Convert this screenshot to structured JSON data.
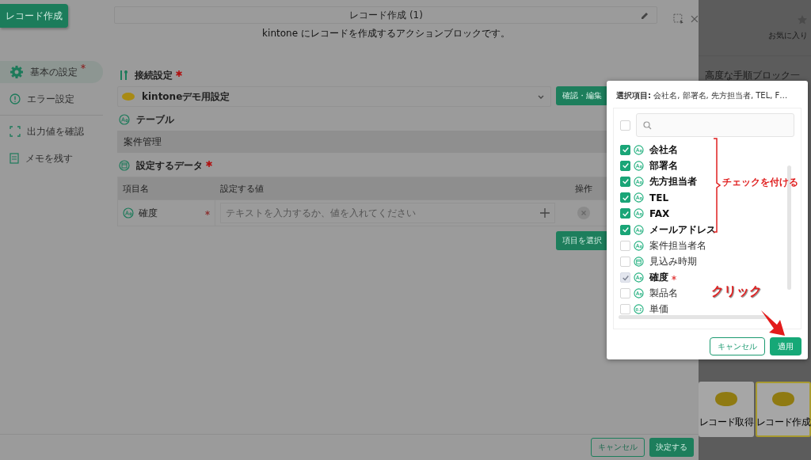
{
  "header": {
    "button": "レコード作成",
    "title": "レコード作成 (1)",
    "subtitle": "kintone にレコードを作成するアクションブロックです。"
  },
  "nav": [
    {
      "label": "基本の設定",
      "required": true,
      "selected": true,
      "kind": "gear"
    },
    {
      "label": "エラー設定",
      "required": false,
      "selected": false,
      "kind": "alert"
    },
    {
      "label": "出力値を確認",
      "required": false,
      "selected": false,
      "kind": "frame"
    },
    {
      "label": "メモを残す",
      "required": false,
      "selected": false,
      "kind": "memo"
    }
  ],
  "connection": {
    "label": "接続設定",
    "required": true,
    "value": "kintoneデモ用設定",
    "button": "確認・編集"
  },
  "table_section": {
    "label": "テーブル",
    "value": "案件管理"
  },
  "data_section": {
    "label": "設定するデータ",
    "required": true,
    "columns": [
      "項目名",
      "設定する値",
      "操作"
    ],
    "rows": [
      {
        "name": "確度",
        "required": true,
        "placeholder": "テキストを入力するか、値を入れてください"
      }
    ],
    "select_button": "項目を選択"
  },
  "footer": {
    "cancel": "キャンセル",
    "ok": "決定する"
  },
  "right_panel": {
    "favorite": "お気に入り",
    "heading": "高度な手順ブロック一",
    "cards": [
      {
        "label": "レコード取得",
        "selected": false
      },
      {
        "label": "レコード作成",
        "selected": true
      }
    ]
  },
  "popup": {
    "summary_label": "選択項目:",
    "summary": "会社名, 部署名, 先方担当者, TEL, F…",
    "select_all": false,
    "items": [
      {
        "label": "会社名",
        "kind": "text",
        "checked": true,
        "disabled": false,
        "required": false
      },
      {
        "label": "部署名",
        "kind": "text",
        "checked": true,
        "disabled": false,
        "required": false
      },
      {
        "label": "先方担当者",
        "kind": "text",
        "checked": true,
        "disabled": false,
        "required": false
      },
      {
        "label": "TEL",
        "kind": "text",
        "checked": true,
        "disabled": false,
        "required": false
      },
      {
        "label": "FAX",
        "kind": "text",
        "checked": true,
        "disabled": false,
        "required": false
      },
      {
        "label": "メールアドレス",
        "kind": "text",
        "checked": true,
        "disabled": false,
        "required": false
      },
      {
        "label": "案件担当者名",
        "kind": "text",
        "checked": false,
        "disabled": false,
        "required": false
      },
      {
        "label": "見込み時期",
        "kind": "date",
        "checked": false,
        "disabled": false,
        "required": false
      },
      {
        "label": "確度",
        "kind": "text",
        "checked": true,
        "disabled": true,
        "required": true
      },
      {
        "label": "製品名",
        "kind": "text",
        "checked": false,
        "disabled": false,
        "required": false
      },
      {
        "label": "単価",
        "kind": "number",
        "checked": false,
        "disabled": false,
        "required": false
      }
    ],
    "cancel": "キャンセル",
    "apply": "適用",
    "annotations": {
      "bracket_note": "チェックを付ける",
      "click_note": "クリック"
    }
  }
}
